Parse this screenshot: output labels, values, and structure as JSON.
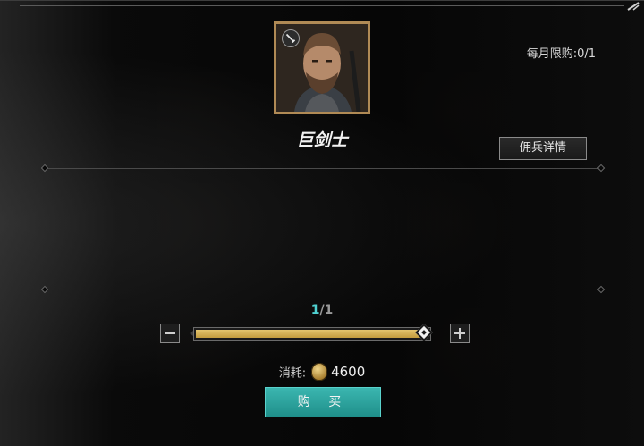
{
  "monthly_limit": "每月限购:0/1",
  "unit": {
    "name": "巨剑士"
  },
  "details_button": "佣兵详情",
  "quantity": {
    "current": "1",
    "separator_total": "/1",
    "fraction": 1.0
  },
  "cost": {
    "label": "消耗:",
    "value": "4600",
    "icon": "coin-icon"
  },
  "buy_button": "购 买",
  "colors": {
    "accent_teal": "#2aa39d",
    "slider_gold": "#d9b556",
    "portrait_frame": "#b08a55"
  }
}
